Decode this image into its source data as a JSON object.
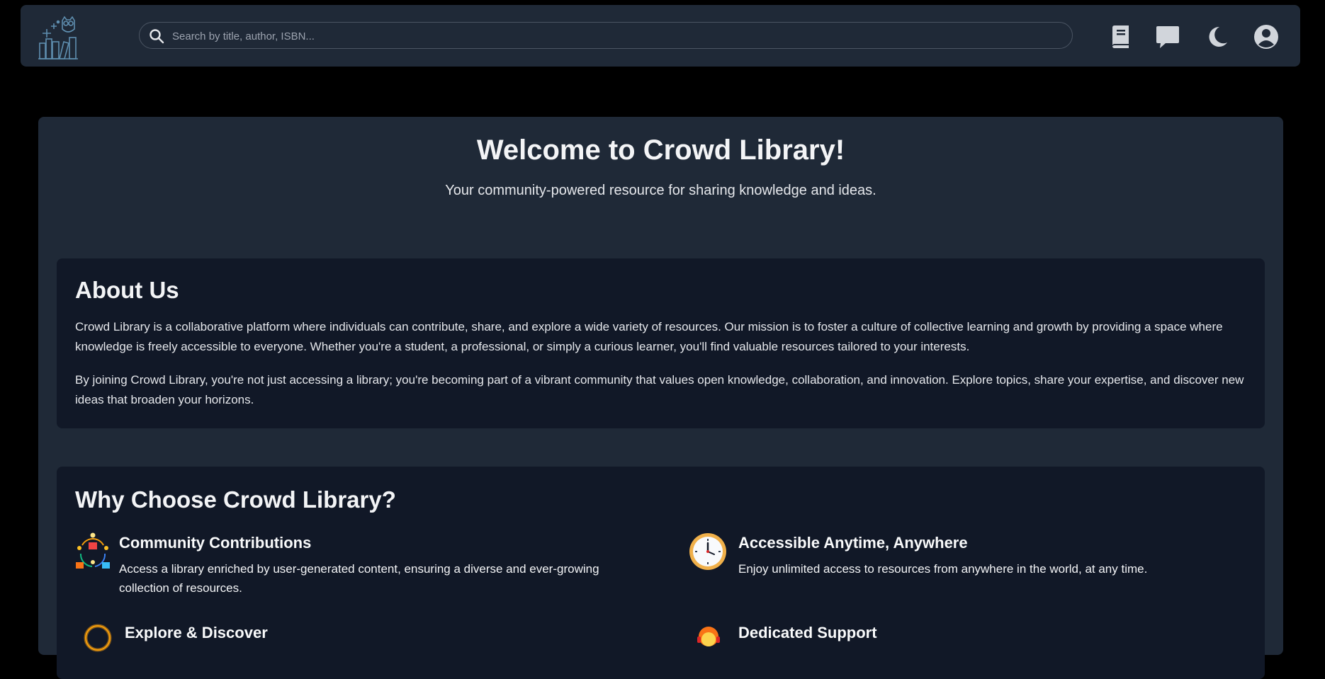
{
  "header": {
    "logo_alt": "Crowd Library logo",
    "search_placeholder": "Search by title, author, ISBN...",
    "icons": [
      "book-icon",
      "chat-icon",
      "moon-icon",
      "user-circle-icon"
    ]
  },
  "hero": {
    "title": "Welcome to Crowd Library!",
    "subtitle": "Your community-powered resource for sharing knowledge and ideas."
  },
  "about": {
    "heading": "About Us",
    "paragraph1": "Crowd Library is a collaborative platform where individuals can contribute, share, and explore a wide variety of resources. Our mission is to foster a culture of collective learning and growth by providing a space where knowledge is freely accessible to everyone. Whether you're a student, a professional, or simply a curious learner, you'll find valuable resources tailored to your interests.",
    "paragraph2": "By joining Crowd Library, you're not just accessing a library; you're becoming part of a vibrant community that values open knowledge, collaboration, and innovation. Explore topics, share your expertise, and discover new ideas that broaden your horizons."
  },
  "why": {
    "heading": "Why Choose Crowd Library?",
    "features": [
      {
        "title": "Community Contributions",
        "text": "Access a library enriched by user-generated content, ensuring a diverse and ever-growing collection of resources.",
        "icon": "community-network-icon"
      },
      {
        "title": "Accessible Anytime, Anywhere",
        "text": "Enjoy unlimited access to resources from anywhere in the world, at any time.",
        "icon": "clock-icon"
      },
      {
        "title": "Explore & Discover",
        "text": "",
        "icon": "discover-ring-icon"
      },
      {
        "title": "Dedicated Support",
        "text": "",
        "icon": "support-agent-icon"
      }
    ]
  },
  "colors": {
    "page_bg": "#000000",
    "nav_bg": "#1f2937",
    "panel_bg": "#1f2937",
    "card_bg": "#111827",
    "text": "#e5e7eb"
  }
}
